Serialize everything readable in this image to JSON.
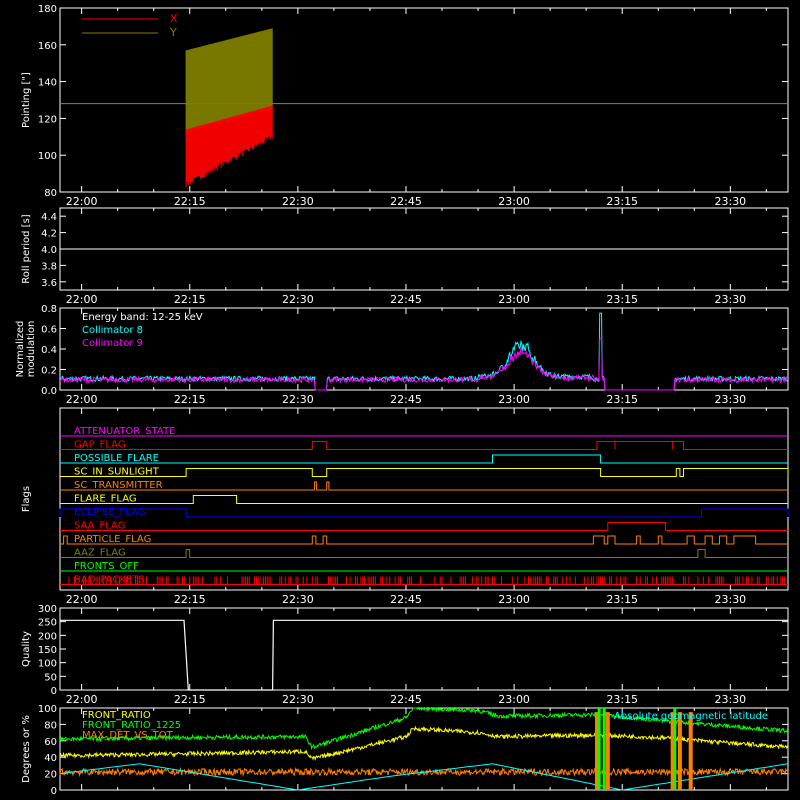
{
  "colors": {
    "bg": "#000000",
    "axes": "#ffffff",
    "x_series": "#ff0000",
    "y_series": "#808000",
    "cyan": "#00ffff",
    "magenta": "#ff00ff",
    "red": "#ff0000",
    "yellow": "#ffff00",
    "orange": "#ff8000",
    "blue": "#0000ff",
    "olive": "#808000",
    "green": "#00ff00"
  },
  "time_ticks": [
    "22:00",
    "22:15",
    "22:30",
    "22:45",
    "23:00",
    "23:15",
    "23:30"
  ],
  "chart_data": [
    {
      "type": "line",
      "panel": "pointing",
      "ylabel": "Pointing [\"]",
      "ylim": [
        80,
        180
      ],
      "yticks": [
        "80",
        "100",
        "120",
        "140",
        "160",
        "180"
      ],
      "legend": {
        "placement": "top-left",
        "entries": [
          "X",
          "Y"
        ]
      },
      "x_units": "minutes since 22:00",
      "xlim": [
        -3,
        98
      ],
      "reference_line": 128,
      "series": [
        {
          "name": "X",
          "color": "#ff0000",
          "x_range": [
            14.5,
            26.5
          ],
          "lower": [
            84,
            110
          ],
          "upper": [
            117,
            130
          ]
        },
        {
          "name": "Y",
          "color": "#808000",
          "x_range": [
            14.5,
            26.5
          ],
          "lower": [
            112,
            126
          ],
          "upper": [
            160,
            172
          ]
        }
      ]
    },
    {
      "type": "line",
      "panel": "roll_period",
      "ylabel": "Roll period [s]",
      "ylim": [
        3.5,
        4.5
      ],
      "yticks": [
        "3.6",
        "3.8",
        "4.0",
        "4.2",
        "4.4"
      ],
      "x_units": "minutes since 22:00",
      "xlim": [
        -3,
        98
      ],
      "series": [
        {
          "x": [
            -3,
            98
          ],
          "values": [
            4.0,
            4.0
          ],
          "color": "#ffffff"
        }
      ]
    },
    {
      "type": "line",
      "panel": "modulation",
      "ylabel": "Normalized modulation",
      "ylim": [
        0,
        0.8
      ],
      "yticks": [
        "0.0",
        "0.2",
        "0.4",
        "0.6",
        "0.8"
      ],
      "legend": {
        "placement": "top-left",
        "entries": [
          "Energy band: 12-25 keV",
          "Collimator 8",
          "Collimator 9"
        ]
      },
      "x_units": "minutes since 22:00",
      "xlim": [
        -3,
        98
      ],
      "series": [
        {
          "name": "Collimator 8",
          "color": "#00ffff",
          "base": 0.1,
          "peak_at": 61,
          "peak_value": 0.4,
          "spike_at": 72,
          "spike_value": 0.75,
          "gaps": [
            [
              32.3,
              34
            ],
            [
              72.5,
              82.3
            ]
          ]
        },
        {
          "name": "Collimator 9",
          "color": "#ff00ff",
          "base": 0.09,
          "peak_at": 61,
          "peak_value": 0.33,
          "spike_at": 72,
          "spike_value": 0.5,
          "gaps": [
            [
              32.3,
              34
            ],
            [
              72.5,
              82.3
            ]
          ]
        }
      ]
    },
    {
      "type": "line",
      "panel": "flags",
      "ylabel": "Flags",
      "x_units": "minutes since 22:00",
      "xlim": [
        -3,
        98
      ],
      "flags": [
        {
          "label": "ATTENUATOR_STATE",
          "color": "#ff00ff",
          "on": []
        },
        {
          "label": "GAP_FLAG",
          "color": "#ff0000",
          "on": [
            [
              32,
              34
            ],
            [
              71.5,
              74
            ],
            [
              74,
              82
            ],
            [
              82,
              83.5
            ]
          ]
        },
        {
          "label": "POSSIBLE_FLARE",
          "color": "#00ffff",
          "on": [
            [
              57,
              72
            ]
          ]
        },
        {
          "label": "SC_IN_SUNLIGHT",
          "color": "#ffff00",
          "on": [
            [
              14.5,
              32
            ],
            [
              34,
              72
            ],
            [
              82.5,
              83
            ],
            [
              83.5,
              98
            ]
          ]
        },
        {
          "label": "SC_TRANSMITTER",
          "color": "#ff8000",
          "on": [
            [
              32.3,
              32.6
            ],
            [
              34,
              34.3
            ]
          ]
        },
        {
          "label": "FLARE_FLAG",
          "color": "#ffff00",
          "on": [
            [
              15.5,
              21.5
            ]
          ]
        },
        {
          "label": "ECLIPSE_FLAG",
          "color": "#0000ff",
          "on": [
            [
              -3,
              14.5
            ],
            [
              86,
              98
            ]
          ]
        },
        {
          "label": "SAA_FLAG",
          "color": "#ff0000",
          "on": [
            [
              73,
              81
            ]
          ]
        },
        {
          "label": "PARTICLE_FLAG",
          "color": "#ff8000",
          "on": [
            [
              -2.5,
              -2
            ],
            [
              32,
              32.5
            ],
            [
              33.5,
              34
            ],
            [
              71,
              72.5
            ],
            [
              73,
              74
            ],
            [
              77,
              77.5
            ],
            [
              80,
              80.5
            ],
            [
              84,
              85
            ],
            [
              86.5,
              87.5
            ],
            [
              88.5,
              89.5
            ],
            [
              90.5,
              93.5
            ]
          ]
        },
        {
          "label": "AAZ_FLAG",
          "color": "#808000",
          "on": [
            [
              14.5,
              15
            ],
            [
              85.5,
              86.5
            ]
          ]
        },
        {
          "label": "FRONTS_OFF",
          "color": "#00ff00",
          "on": []
        },
        {
          "label": "BAD_PACKETS",
          "color": "#ff0000",
          "on": [
            [
              -3,
              98
            ]
          ]
        }
      ]
    },
    {
      "type": "line",
      "panel": "quality",
      "ylabel": "Quality",
      "ylim": [
        0,
        300
      ],
      "yticks": [
        "0",
        "50",
        "100",
        "150",
        "200",
        "250",
        "300"
      ],
      "x_units": "minutes since 22:00",
      "xlim": [
        -3,
        98
      ],
      "series": [
        {
          "x": [
            -3,
            14.2,
            14.8,
            26.5,
            26.6,
            98
          ],
          "values": [
            255,
            255,
            0,
            0,
            255,
            255
          ],
          "color": "#ffffff"
        }
      ]
    },
    {
      "type": "line",
      "panel": "geo",
      "ylabel": "Degrees or %",
      "ylim": [
        0,
        100
      ],
      "yticks": [
        "0",
        "20",
        "40",
        "60",
        "80",
        "100"
      ],
      "legend": {
        "placement": "top-left",
        "entries": [
          "FRONT_RATIO",
          "FRONT_RATIO_1225",
          "MAX_DET_VS_TOT"
        ]
      },
      "annotation": "Absolute geomagnetic latitude",
      "x_units": "minutes since 22:00",
      "xlim": [
        -3,
        98
      ],
      "series": [
        {
          "name": "FRONT_RATIO_1225",
          "color": "#00ff00",
          "x": [
            -3,
            14,
            31,
            32,
            45,
            46,
            55,
            58,
            72,
            80,
            98
          ],
          "values": [
            62,
            64,
            65,
            52,
            88,
            100,
            97,
            90,
            92,
            85,
            72
          ]
        },
        {
          "name": "FRONT_RATIO",
          "color": "#ffff00",
          "x": [
            -3,
            14,
            31,
            32,
            45,
            46,
            55,
            58,
            72,
            80,
            98
          ],
          "values": [
            42,
            44,
            47,
            38,
            65,
            75,
            70,
            65,
            67,
            64,
            52
          ]
        },
        {
          "name": "MAX_DET_VS_TOT",
          "color": "#ff8000",
          "x": [
            -3,
            98
          ],
          "values": [
            22,
            22
          ]
        },
        {
          "name": "Absolute geomagnetic latitude",
          "color": "#00ffff",
          "x": [
            -3,
            8,
            30,
            43,
            57,
            75,
            98
          ],
          "values": [
            20,
            32,
            0,
            17,
            32,
            0,
            32
          ]
        }
      ],
      "spikes_orange": [
        71.5,
        73,
        82,
        83,
        84.5
      ],
      "spikes_green": [
        71.8,
        72.5,
        82.3
      ]
    }
  ]
}
